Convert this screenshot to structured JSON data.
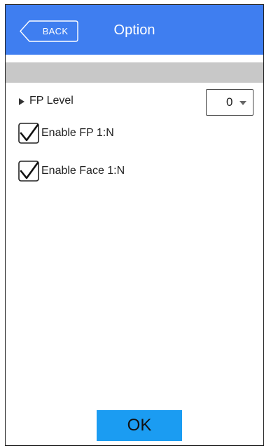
{
  "header": {
    "back_label": "BACK",
    "title": "Option",
    "color": "#3f7ef0"
  },
  "settings": {
    "fp_level": {
      "label": "FP Level",
      "icon": "right-triangle-icon",
      "selected_value": "0",
      "dropdown_icon": "caret-down-icon"
    },
    "enable_fp_1n": {
      "label": "Enable FP 1:N",
      "checked": true
    },
    "enable_face_1n": {
      "label": "Enable Face 1:N",
      "checked": true
    }
  },
  "footer": {
    "ok_label": "OK",
    "ok_color": "#1b9cf2"
  }
}
